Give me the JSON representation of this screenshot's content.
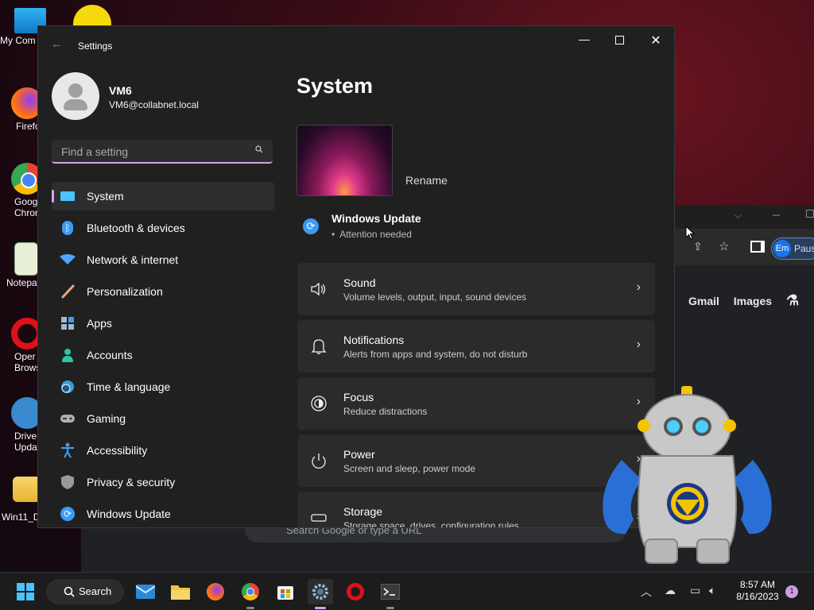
{
  "desktop": {
    "icons": [
      {
        "label": "My Com"
      },
      {
        "label": "Firefo"
      },
      {
        "label": "Goog\nChron"
      },
      {
        "label": "Notepa"
      },
      {
        "label": "Oper\nBrows"
      },
      {
        "label": "Drive\nUpdat"
      },
      {
        "label": "Win11_D"
      }
    ]
  },
  "browser": {
    "profile_initials": "Em",
    "profile_status": "Paus",
    "links": [
      "Gmail",
      "Images"
    ],
    "search_placeholder": "Search Google or type a URL"
  },
  "settings": {
    "window_title": "Settings",
    "user": {
      "name": "VM6",
      "email": "VM6@collabnet.local"
    },
    "search_placeholder": "Find a setting",
    "nav": [
      {
        "label": "System",
        "active": true,
        "icon": "monitor-icon",
        "color": "#4cc2ff"
      },
      {
        "label": "Bluetooth & devices",
        "icon": "bluetooth-icon",
        "color": "#3b9cf5"
      },
      {
        "label": "Network & internet",
        "icon": "wifi-icon",
        "color": "#4aa8ff"
      },
      {
        "label": "Personalization",
        "icon": "brush-icon",
        "color": "#e8a87c"
      },
      {
        "label": "Apps",
        "icon": "apps-icon",
        "color": "#a0b8d0"
      },
      {
        "label": "Accounts",
        "icon": "person-icon",
        "color": "#2fc4a8"
      },
      {
        "label": "Time & language",
        "icon": "globe-clock-icon",
        "color": "#3a9ad9"
      },
      {
        "label": "Gaming",
        "icon": "gamepad-icon",
        "color": "#b0b0b0"
      },
      {
        "label": "Accessibility",
        "icon": "accessibility-icon",
        "color": "#3b9cf5"
      },
      {
        "label": "Privacy & security",
        "icon": "shield-icon",
        "color": "#9a9a9a"
      },
      {
        "label": "Windows Update",
        "icon": "sync-icon",
        "color": "#3b9cf5"
      }
    ],
    "page_title": "System",
    "rename_label": "Rename",
    "windows_update": {
      "title": "Windows Update",
      "status": "Attention needed"
    },
    "cards": [
      {
        "title": "Sound",
        "subtitle": "Volume levels, output, input, sound devices",
        "icon": "speaker-icon"
      },
      {
        "title": "Notifications",
        "subtitle": "Alerts from apps and system, do not disturb",
        "icon": "bell-icon"
      },
      {
        "title": "Focus",
        "subtitle": "Reduce distractions",
        "icon": "focus-icon"
      },
      {
        "title": "Power",
        "subtitle": "Screen and sleep, power mode",
        "icon": "power-icon"
      },
      {
        "title": "Storage",
        "subtitle": "Storage space, drives, configuration rules",
        "icon": "storage-icon"
      }
    ]
  },
  "taskbar": {
    "search_label": "Search",
    "time": "8:57 AM",
    "date": "8/16/2023",
    "notification_count": "1",
    "apps": [
      "start",
      "search",
      "mail",
      "file-explorer",
      "firefox",
      "chrome",
      "store",
      "settings",
      "opera",
      "terminal"
    ]
  }
}
